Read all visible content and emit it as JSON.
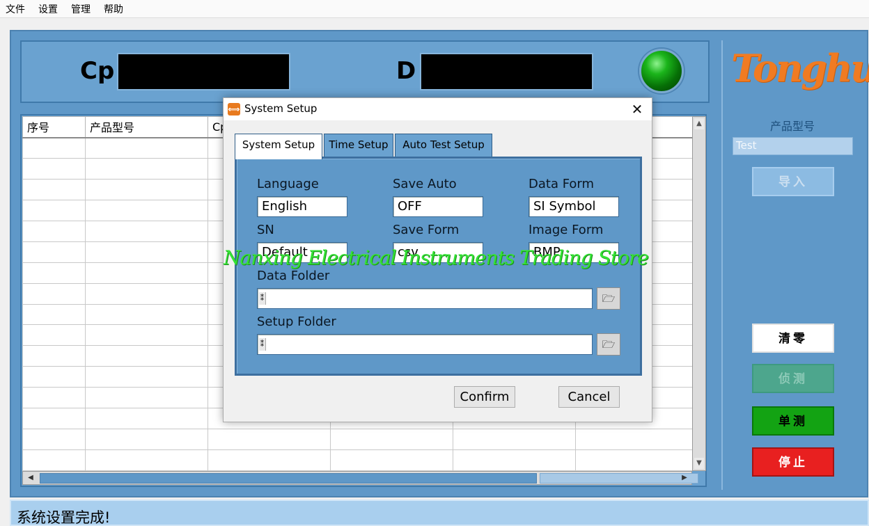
{
  "menu": {
    "items": [
      "文件",
      "设置",
      "管理",
      "帮助"
    ]
  },
  "readout": {
    "cp_label": "Cp",
    "d_label": "D"
  },
  "table": {
    "headers": [
      "序号",
      "产品型号",
      "Cp",
      "",
      "",
      ""
    ]
  },
  "side": {
    "logo": "Tonghui",
    "product_label": "产品型号",
    "product_value": "Test",
    "import_label": "导入",
    "zero_label": "清零",
    "detect_label": "侦测",
    "single_label": "单测",
    "stop_label": "停止"
  },
  "status": {
    "message": "系统设置完成!"
  },
  "dialog": {
    "title": "System Setup",
    "tabs": [
      "System Setup",
      "Time Setup",
      "Auto Test Setup"
    ],
    "fields": {
      "language_label": "Language",
      "language_value": "English",
      "save_auto_label": "Save Auto",
      "save_auto_value": "OFF",
      "data_form_label": "Data Form",
      "data_form_value": "SI Symbol",
      "sn_label": "SN",
      "sn_value": "Default",
      "save_form_label": "Save Form",
      "save_form_value": "csv",
      "image_form_label": "Image Form",
      "image_form_value": "BMP",
      "data_folder_label": "Data Folder",
      "data_folder_value": "",
      "setup_folder_label": "Setup Folder",
      "setup_folder_value": ""
    },
    "confirm_label": "Confirm",
    "cancel_label": "Cancel"
  },
  "watermark": "Nanxing Electrical Instruments Trading Store",
  "colors": {
    "panel_blue": "#5f98c8",
    "led_green": "#1bb51b",
    "logo_orange": "#f07b22",
    "stop_red": "#e82020",
    "single_green": "#13a313",
    "watermark_green": "#34e334"
  },
  "icons": [
    "close-icon",
    "folder-open-icon",
    "path-icon",
    "scroll-up-arrow-icon",
    "scroll-down-arrow-icon",
    "scroll-left-arrow-icon",
    "scroll-right-arrow-icon",
    "app-icon"
  ]
}
